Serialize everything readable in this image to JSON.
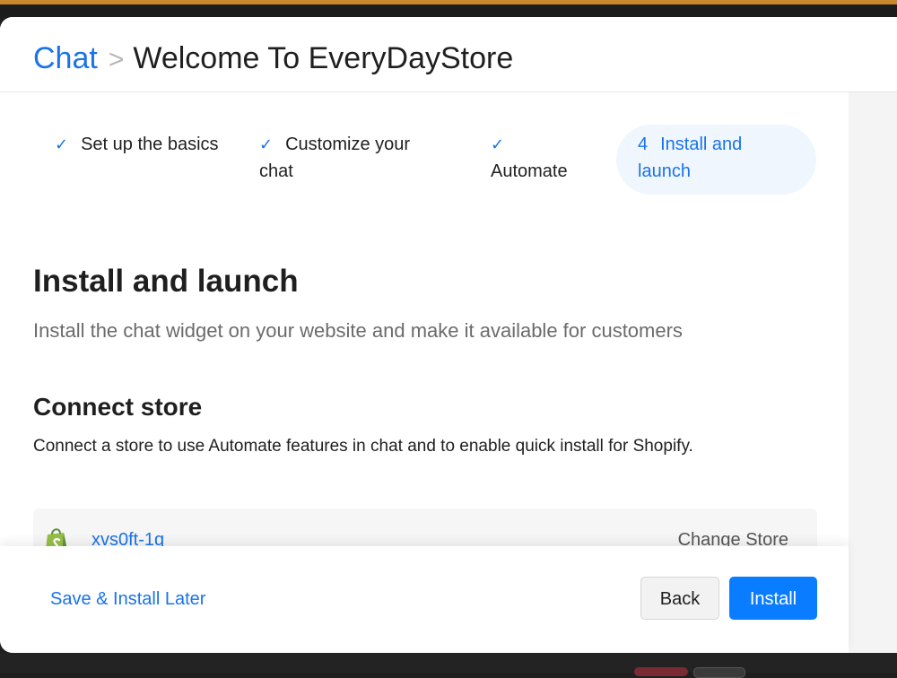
{
  "header": {
    "breadcrumb_root": "Chat",
    "separator": ">",
    "title": "Welcome To EveryDayStore"
  },
  "steps": [
    {
      "label": "Set up the basics",
      "state": "done",
      "marker": "✓"
    },
    {
      "label": "Customize your chat",
      "state": "done",
      "marker": "✓"
    },
    {
      "label": "Automate",
      "state": "done",
      "marker": "✓"
    },
    {
      "label": "Install and launch",
      "state": "current",
      "marker": "4"
    }
  ],
  "main": {
    "title": "Install and launch",
    "description": "Install the chat widget on your website and make it available for customers",
    "connect": {
      "title": "Connect store",
      "description": "Connect a store to use Automate features in chat and to enable quick install for Shopify.",
      "store_name": "xvs0ft-1q",
      "store_icon": "shopify-bag-icon",
      "change_label": "Change Store"
    }
  },
  "footer": {
    "save_later_label": "Save & Install Later",
    "back_label": "Back",
    "install_label": "Install"
  },
  "colors": {
    "accent": "#1a73e8",
    "primary_button": "#0a7cff",
    "shopify_green": "#95bf47"
  }
}
